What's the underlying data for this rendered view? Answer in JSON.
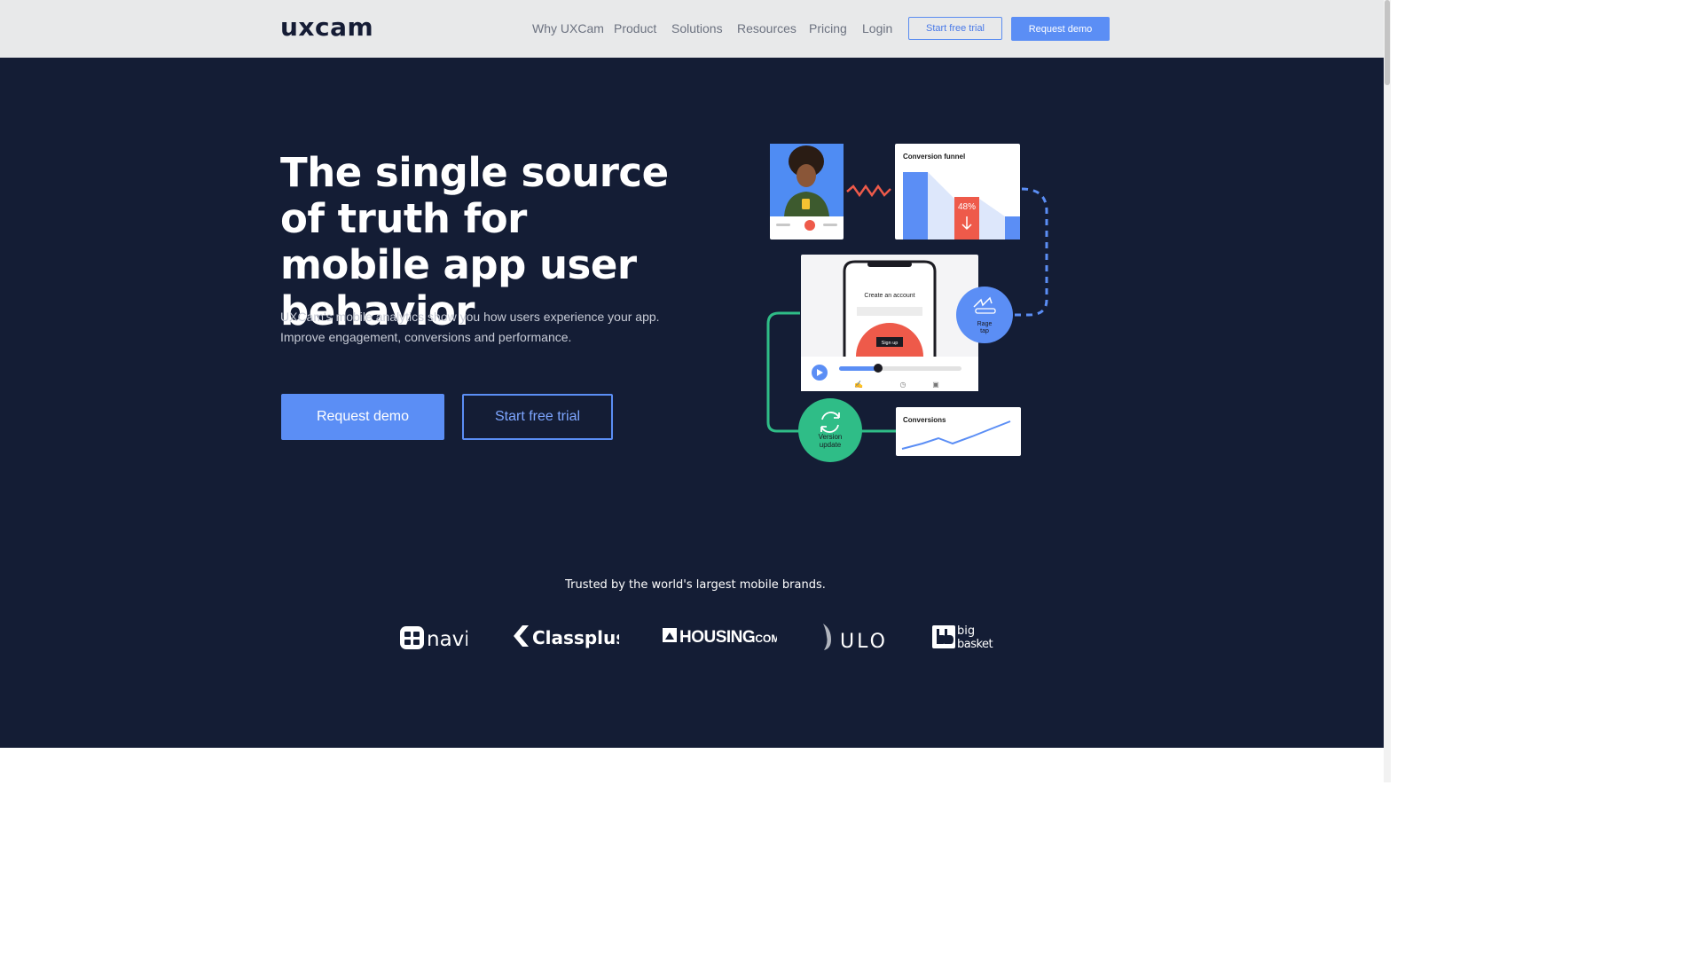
{
  "app": {
    "logo_text": "uxcam"
  },
  "nav": {
    "links": [
      {
        "label": "Why UXCam"
      },
      {
        "label": "Product"
      },
      {
        "label": "Solutions"
      },
      {
        "label": "Resources"
      },
      {
        "label": "Pricing"
      },
      {
        "label": "Login"
      }
    ],
    "start_trial_label": "Start free trial",
    "request_demo_label": "Request demo"
  },
  "hero": {
    "title": "The single source of truth for mobile app user behavior",
    "subtitle_line1": "UXCam's mobile analytics show you how users experience your app.",
    "subtitle_line2": "Improve engagement, conversions and performance.",
    "primary_cta": "Request demo",
    "secondary_cta": "Start free trial"
  },
  "illustration": {
    "funnel_title": "Conversion funnel",
    "funnel_percent": "48%",
    "phone_title": "Create an account",
    "phone_button": "Sign up",
    "rage_tap_line1": "Rage",
    "rage_tap_line2": "tap",
    "version_line1": "Version",
    "version_line2": "update",
    "conversions_title": "Conversions"
  },
  "trusted": {
    "heading": "Trusted by the world's largest mobile brands.",
    "brands": [
      "navi",
      "Classplus",
      "HOUSING.COM",
      "JULO",
      "big basket"
    ]
  },
  "brand_text": {
    "navi": "navi",
    "classplus": "Classplus",
    "housing": "HOUSING",
    "housing_suffix": ".COM",
    "julo": "ULO",
    "big": "big",
    "basket": "basket"
  },
  "colors": {
    "hero_bg": "#141d35",
    "accent_blue": "#5b8ef5",
    "accent_red": "#ee5a4a",
    "accent_green": "#2fbd87"
  }
}
